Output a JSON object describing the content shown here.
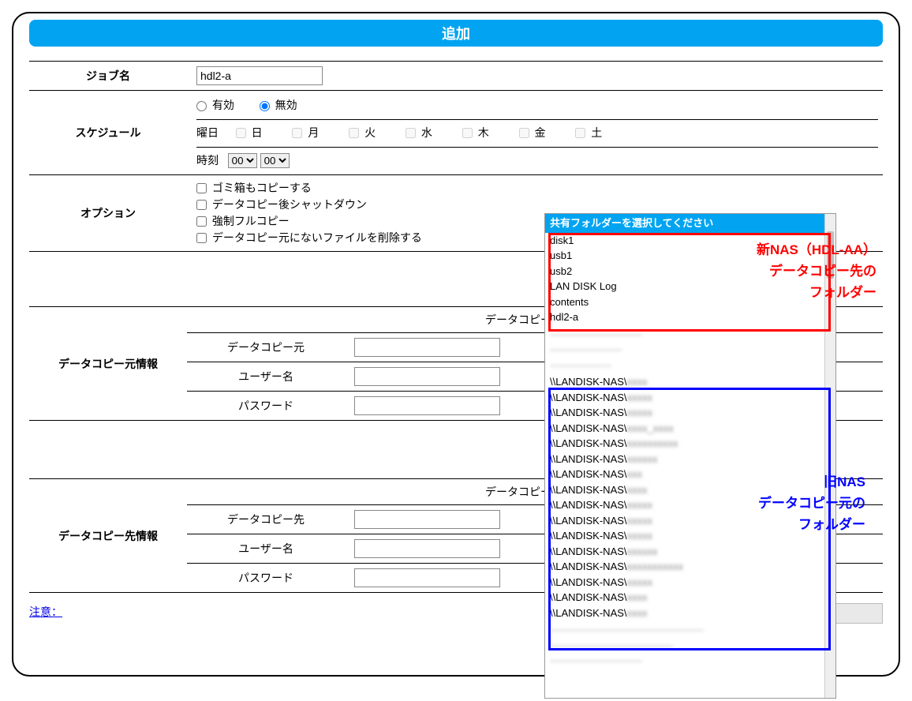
{
  "header": {
    "title": "追加"
  },
  "rows": {
    "jobname_label": "ジョブ名",
    "jobname_value": "hdl2-a",
    "schedule_label": "スケジュール",
    "enabled_label": "有効",
    "disabled_label": "無効",
    "dow_label": "曜日",
    "days": {
      "sun": "日",
      "mon": "月",
      "tue": "火",
      "wed": "水",
      "thu": "木",
      "fri": "金",
      "sat": "土"
    },
    "time_label": "時刻",
    "time_hour": "00",
    "time_min": "00",
    "options_label": "オプション",
    "opt_trash": "ゴミ箱もコピーする",
    "opt_shutdown": "データコピー後シャットダウン",
    "opt_fullcopy": "強制フルコピー",
    "opt_deletemissing": "データコピー元にないファイルを削除する",
    "src_info_label": "データコピー元情報",
    "src_section": "データコピー元設定",
    "src_label": "データコピー元",
    "user_label": "ユーザー名",
    "pass_label": "パスワード",
    "dst_info_label": "データコピー先情報",
    "dst_section": "データコピー先設定",
    "dst_label": "データコピー先",
    "note_label": "注意："
  },
  "folder_popup": {
    "title": "共有フォルダーを選択してください",
    "local": [
      "disk1",
      "usb1",
      "usb2",
      "LAN DISK Log",
      "contents",
      "hdl2-a"
    ],
    "blurred_top": [
      "—————————",
      "———————",
      "——————"
    ],
    "remote": [
      "\\\\LANDISK-NAS\\",
      "\\\\LANDISK-NAS\\",
      "\\\\LANDISK-NAS\\",
      "\\\\LANDISK-NAS\\",
      "\\\\LANDISK-NAS\\",
      "\\\\LANDISK-NAS\\",
      "\\\\LANDISK-NAS\\",
      "\\\\LANDISK-NAS\\",
      "\\\\LANDISK-NAS\\",
      "\\\\LANDISK-NAS\\",
      "\\\\LANDISK-NAS\\",
      "\\\\LANDISK-NAS\\",
      "\\\\LANDISK-NAS\\",
      "\\\\LANDISK-NAS\\",
      "\\\\LANDISK-NAS\\",
      "\\\\LANDISK-NAS\\"
    ],
    "remote_blur": [
      "xxxx",
      "xxxxx",
      "xxxxx",
      "xxxx_xxxx",
      "xxxxxxxxxx",
      "xxxxxx",
      "xxx",
      "xxxx",
      "xxxxx",
      "xxxxx",
      "xxxxx",
      "xxxxxx",
      "xxxxxxxxxxx",
      "xxxxx",
      "xxxx",
      "xxxx"
    ],
    "blurred_bottom": [
      "———————————————",
      "————————————",
      "—————————"
    ]
  },
  "annotations": {
    "red": "新NAS（HDL-AA）\nデータコピー先の\nフォルダー",
    "blue": "旧NAS\nデータコピー元の\nフォルダー"
  }
}
